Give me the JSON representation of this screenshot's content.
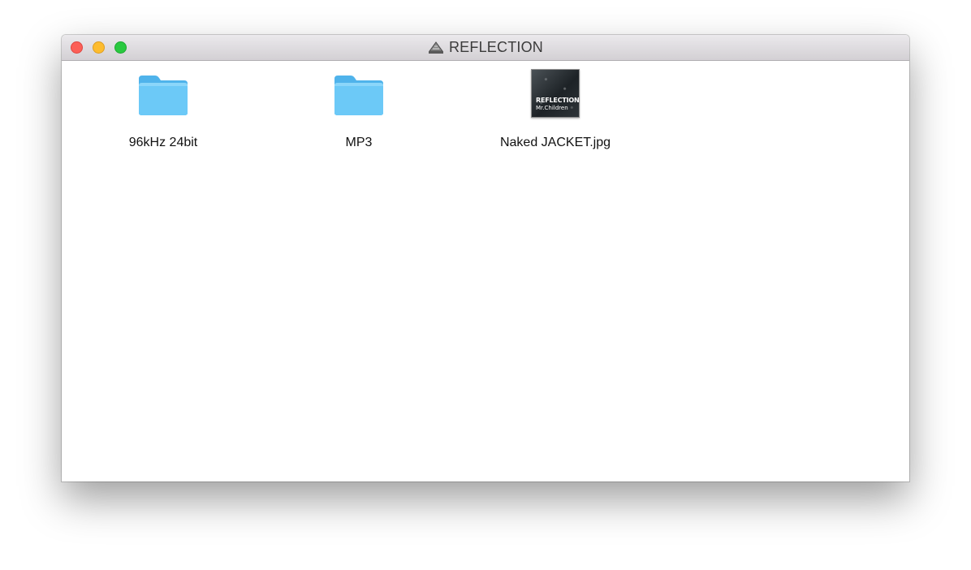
{
  "window": {
    "title": "REFLECTION",
    "title_icon": "disk-image-icon"
  },
  "items": [
    {
      "label": "96kHz 24bit",
      "kind": "folder",
      "icon": "folder-icon"
    },
    {
      "label": "MP3",
      "kind": "folder",
      "icon": "folder-icon"
    },
    {
      "label": "Naked JACKET.jpg",
      "kind": "image",
      "icon": "image-thumbnail-icon",
      "thumbnail_text": [
        "REFLECTION",
        "Mr.Children"
      ]
    }
  ],
  "colors": {
    "folder": "#5cc1f5",
    "close": "#fc5f57",
    "minimize": "#fdbc2e",
    "zoom": "#2ac940"
  }
}
